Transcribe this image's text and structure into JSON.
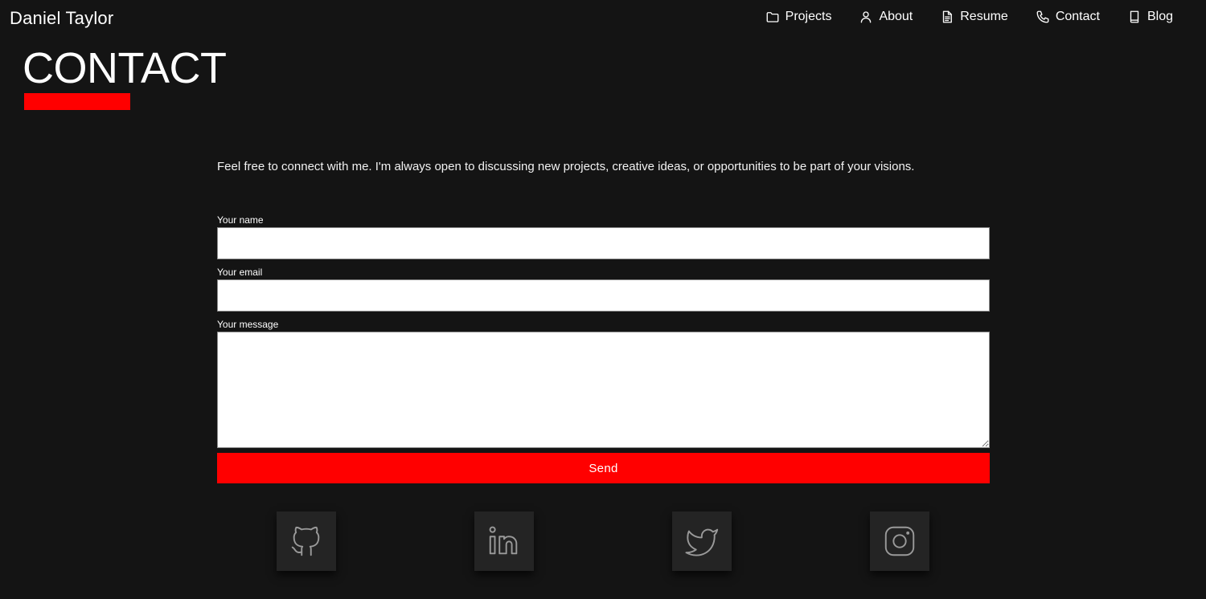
{
  "header": {
    "brand": "Daniel Taylor",
    "nav": [
      {
        "label": "Projects",
        "icon": "folder-icon"
      },
      {
        "label": "About",
        "icon": "user-icon"
      },
      {
        "label": "Resume",
        "icon": "document-icon"
      },
      {
        "label": "Contact",
        "icon": "phone-icon"
      },
      {
        "label": "Blog",
        "icon": "book-icon"
      }
    ]
  },
  "main": {
    "title": "CONTACT",
    "intro": "Feel free to connect with me. I'm always open to discussing new projects, creative ideas, or opportunities to be part of your visions."
  },
  "form": {
    "name_label": "Your name",
    "name_value": "",
    "email_label": "Your email",
    "email_value": "",
    "message_label": "Your message",
    "message_value": "",
    "send_label": "Send"
  },
  "socials": [
    {
      "icon": "github-icon"
    },
    {
      "icon": "linkedin-icon"
    },
    {
      "icon": "twitter-icon"
    },
    {
      "icon": "instagram-icon"
    }
  ],
  "colors": {
    "background": "#141414",
    "accent": "#ff0000",
    "tile": "#242424",
    "icon_stroke": "#9a9a9a"
  }
}
